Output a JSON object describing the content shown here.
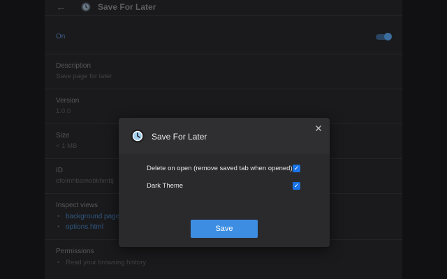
{
  "header": {
    "back_icon": "arrow-left-icon",
    "extension_icon": "clock-icon",
    "title": "Save For Later"
  },
  "enabled": {
    "label": "On",
    "toggle_on": true
  },
  "details": {
    "description_label": "Description",
    "description_value": "Save page for later",
    "version_label": "Version",
    "version_value": "1.0.0",
    "size_label": "Size",
    "size_value": "< 1 MB",
    "id_label": "ID",
    "id_value": "efolmhbamobkhmbj",
    "inspect_label": "Inspect views",
    "inspect_views": [
      "background page",
      "options.html"
    ],
    "permissions_label": "Permissions",
    "permissions": [
      "Read your browsing history"
    ]
  },
  "dialog": {
    "icon": "clock-icon",
    "title": "Save For Later",
    "close_icon": "close-icon",
    "options": [
      {
        "label": "Delete on open (remove saved tab when opened)",
        "checked": true
      },
      {
        "label": "Dark Theme",
        "checked": true
      }
    ],
    "save_label": "Save"
  },
  "colors": {
    "accent": "#1a73e8",
    "save_button": "#3d8ee3",
    "background": "#111113"
  }
}
